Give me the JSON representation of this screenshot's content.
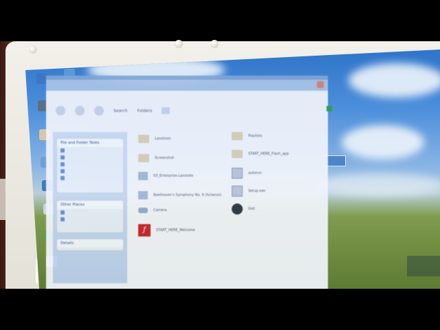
{
  "explorer": {
    "toolbar": {
      "search_label": "Search",
      "folders_label": "Folders"
    },
    "task_panels": {
      "file_folder_tasks": {
        "title": "File and Folder Tasks"
      },
      "other_places": {
        "title": "Other Places"
      },
      "details": {
        "title": "Details"
      }
    },
    "files": [
      {
        "name": "Lanstrom",
        "icon": "folder-icon"
      },
      {
        "name": "Playlists",
        "icon": "folder-icon"
      },
      {
        "name": "Screenshot",
        "icon": "folder-icon"
      },
      {
        "name": "START_HERE_Flash_app",
        "icon": "folder-icon"
      },
      {
        "name": "03_Enterprise-Lanstate",
        "icon": "audio-icon"
      },
      {
        "name": "autorun",
        "icon": "setup-icon"
      },
      {
        "name": "Beethoven's Symphony No. 9 (Scherzo)",
        "icon": "audio-icon"
      },
      {
        "name": "Camera",
        "icon": "camera-icon"
      },
      {
        "name": "Dell",
        "icon": "dell-logo-icon"
      },
      {
        "name": "START_HERE_Welcome",
        "icon": "flash-icon"
      },
      {
        "name": "Setup.exe",
        "icon": "setup-icon"
      }
    ]
  },
  "accent_colors": {
    "window_border": "#7fa5d6",
    "task_pane": "#bcd0ef",
    "flash_red": "#c8202a"
  }
}
